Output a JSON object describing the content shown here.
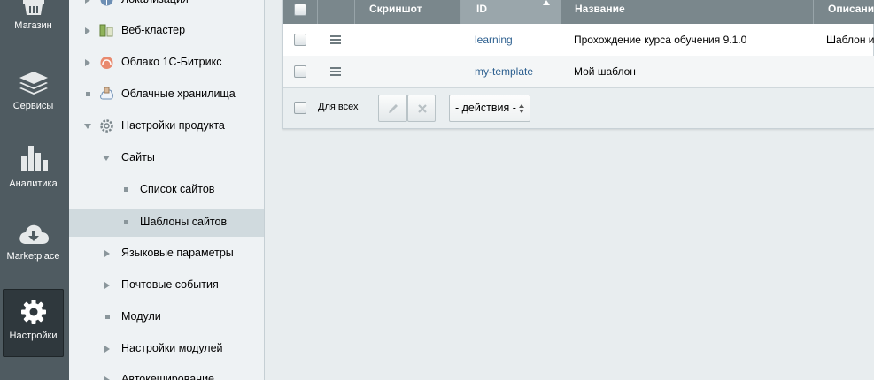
{
  "rail": {
    "items": [
      {
        "label": "Магазин",
        "icon": "basket-icon"
      },
      {
        "label": "Сервисы",
        "icon": "layers-icon"
      },
      {
        "label": "Аналитика",
        "icon": "bar-chart-icon"
      },
      {
        "label": "Marketplace",
        "icon": "cloud-download-icon"
      },
      {
        "label": "Настройки",
        "icon": "gear-icon",
        "active": true
      }
    ]
  },
  "menu": {
    "items": [
      {
        "label": "Локализация"
      },
      {
        "label": "Веб-кластер"
      },
      {
        "label": "Облако 1С-Битрикс"
      },
      {
        "label": "Облачные хранилища"
      },
      {
        "label": "Настройки продукта"
      },
      {
        "label": "Сайты"
      },
      {
        "label": "Список сайтов"
      },
      {
        "label": "Шаблоны сайтов",
        "selected": true
      },
      {
        "label": "Языковые параметры"
      },
      {
        "label": "Почтовые события"
      },
      {
        "label": "Модули"
      },
      {
        "label": "Настройки модулей"
      },
      {
        "label": "Автокеширование"
      }
    ]
  },
  "grid": {
    "columns": [
      "Скриншот",
      "ID",
      "Название",
      "Описани"
    ],
    "sorted_column": "ID",
    "rows": [
      {
        "id": "learning",
        "name": "Прохождение курса обучения 9.1.0",
        "description": "Шаблон и"
      },
      {
        "id": "my-template",
        "name": "Мой шаблон",
        "description": ""
      }
    ],
    "footer": {
      "for_all_label": "Для всех",
      "actions_select": "- действия -"
    }
  },
  "colors": {
    "rail_bg": "#4f5b61",
    "header_bg": "#7a878c",
    "link": "#2c5f8f"
  }
}
